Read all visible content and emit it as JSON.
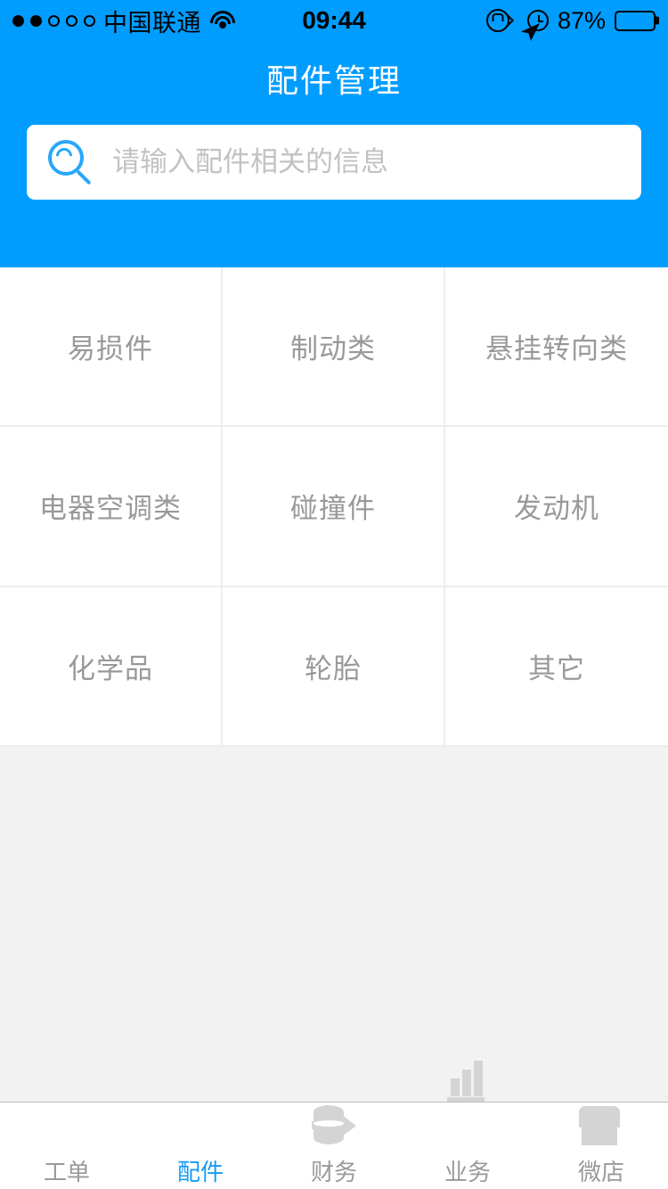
{
  "status_bar": {
    "signal_dots_filled": 2,
    "signal_dots_total": 5,
    "carrier": "中国联通",
    "wifi_icon": "wifi-icon",
    "time": "09:44",
    "rotation_lock_icon": "rotation-lock-icon",
    "location_icon": "location-arrow-icon",
    "alarm_icon": "alarm-clock-icon",
    "battery_percent": "87%",
    "battery_level": 87
  },
  "header": {
    "title": "配件管理",
    "background_color": "#009dff"
  },
  "search": {
    "icon": "search-icon",
    "placeholder": "请输入配件相关的信息",
    "value": ""
  },
  "categories": [
    {
      "label": "易损件"
    },
    {
      "label": "制动类"
    },
    {
      "label": "悬挂转向类"
    },
    {
      "label": "电器空调类"
    },
    {
      "label": "碰撞件"
    },
    {
      "label": "发动机"
    },
    {
      "label": "化学品"
    },
    {
      "label": "轮胎"
    },
    {
      "label": "其它"
    }
  ],
  "tabbar": {
    "active_color": "#149bf5",
    "inactive_color": "#9a9a9a",
    "items": [
      {
        "label": "工单",
        "icon": "document-icon",
        "active": false
      },
      {
        "label": "配件",
        "icon": "pie-chart-icon",
        "active": true
      },
      {
        "label": "财务",
        "icon": "coins-transfer-icon",
        "active": false
      },
      {
        "label": "业务",
        "icon": "bar-chart-icon",
        "active": false
      },
      {
        "label": "微店",
        "icon": "shop-icon",
        "active": false
      }
    ]
  }
}
